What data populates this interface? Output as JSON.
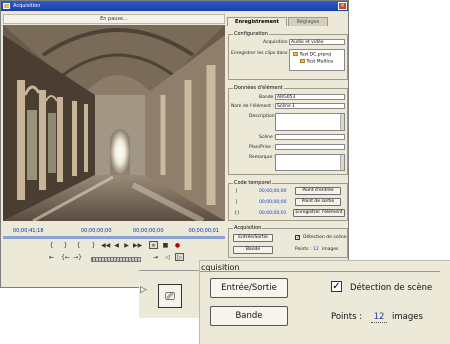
{
  "window": {
    "title": "Acquisition",
    "close_glyph": "×"
  },
  "monitor": {
    "header": "En pause...",
    "timecodes": {
      "left": "00;00;41;18",
      "mid1": "00;00;00;00",
      "mid2": "00;00;00;00",
      "right": "00;00;00;01"
    }
  },
  "transport": {
    "row1": [
      "{",
      "}",
      "{",
      "}",
      "◀◀",
      "◀",
      "▶",
      "▶▶",
      "⏸",
      "■",
      "●"
    ],
    "row2": [
      "⇤",
      "{←",
      "→}",
      "⇥",
      "◁",
      "▷",
      "⏎"
    ]
  },
  "tabs": {
    "active": "Enregistrement",
    "inactive": "Réglages"
  },
  "configuration": {
    "title": "Configuration",
    "acquisition_label": "Acquisition :",
    "acquisition_value": "Audio et vidéo",
    "save_label": "Enregistrer les clips dans :",
    "tree": [
      "Test DC.prproj",
      "Test Multica"
    ]
  },
  "clip_data": {
    "title": "Données d'élément",
    "fields": [
      {
        "label": "Bande :",
        "value": "ARG053"
      },
      {
        "label": "Nom de l'élément :",
        "value": "Scène 1"
      },
      {
        "label": "Description :",
        "value": ""
      },
      {
        "label": "Scène :",
        "value": ""
      },
      {
        "label": "Plan/Prise :",
        "value": ""
      },
      {
        "label": "Remarque :",
        "value": ""
      }
    ]
  },
  "timecode_panel": {
    "title": "Code temporel",
    "rows": [
      {
        "mark": "{",
        "value": "00;00;00;00",
        "button": "Point d'entrée"
      },
      {
        "mark": "}",
        "value": "00;00;00;00",
        "button": "Point de sortie"
      },
      {
        "mark": "{}",
        "value": "00;00;00;01",
        "button": "Enregistrer l'élément"
      }
    ]
  },
  "capture_panel": {
    "title": "Acquisition",
    "in_out_label": "Entrée/Sortie",
    "tape_label": "Bande",
    "scene_detect_label": "Détection de scène",
    "scene_detect_checked": "✓",
    "points_label": "Points :",
    "points_value": "12",
    "points_unit": "images"
  },
  "zoom": {
    "title": "cquisition",
    "in_out_label": "Entrée/Sortie",
    "tape_label": "Bande",
    "scene_detect_label": "Détection de scène",
    "scene_detect_checked": "✓",
    "points_label": "Points :",
    "points_value": "12",
    "points_unit": "images"
  },
  "colors": {
    "title_bar": "#1f4bb8",
    "timecode": "#1440c8",
    "panel_bg": "#ece9d8"
  },
  "icons": {
    "scene_icon": "film-frame-icon"
  }
}
